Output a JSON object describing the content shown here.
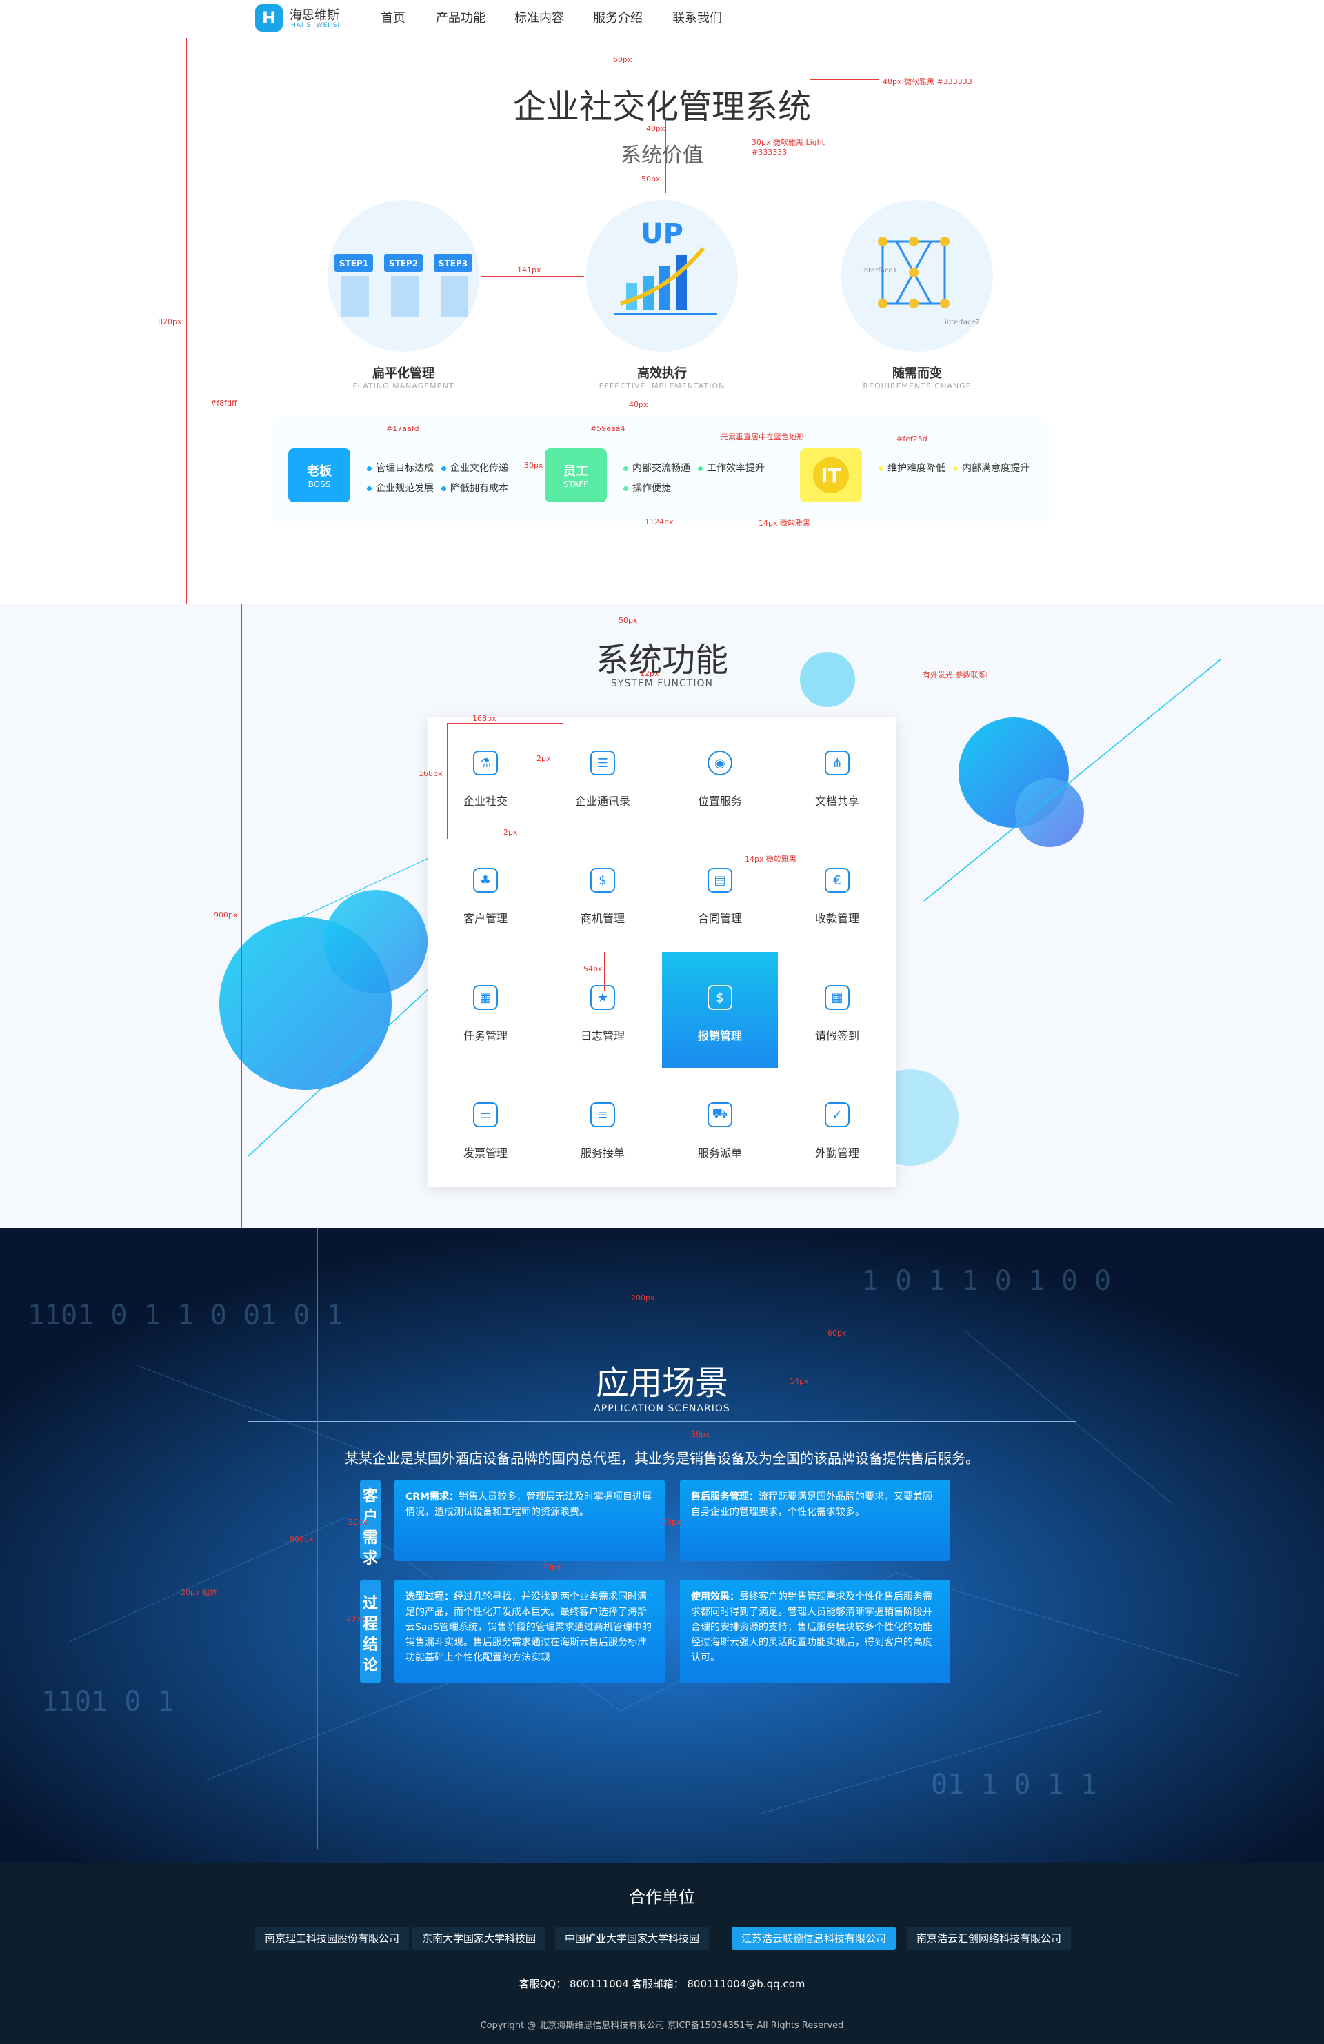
{
  "header": {
    "logo_text": "海思维斯",
    "logo_sub": "HAI SI WEI SI",
    "nav": [
      "首页",
      "产品功能",
      "标准内容",
      "服务介绍",
      "联系我们"
    ]
  },
  "section1": {
    "title": "企业社交化管理系统",
    "subtitle": "系统价值",
    "features": [
      {
        "title": "扁平化管理",
        "sub": "FLATING MANAGEMENT",
        "icon": "steps-icon",
        "steps": [
          "STEP1",
          "STEP2",
          "STEP3"
        ]
      },
      {
        "title": "高效执行",
        "sub": "EFFECTIVE IMPLEMENTATION",
        "icon": "up-chart-icon",
        "badge": "UP"
      },
      {
        "title": "随需而变",
        "sub": "REQUIREMENTS CHANGE",
        "icon": "interface-network-icon",
        "labels": [
          "interface1",
          "interface2"
        ]
      }
    ],
    "roles": [
      {
        "name": "老板",
        "en": "BOSS",
        "color": "#17aafd",
        "items": [
          "管理目标达成",
          "企业文化传递",
          "企业规范发展",
          "降低拥有成本"
        ]
      },
      {
        "name": "员工",
        "en": "STAFF",
        "color": "#59eaa4",
        "items": [
          "内部交流畅通",
          "工作效率提升",
          "操作便捷"
        ]
      },
      {
        "name": "IT",
        "en": "",
        "color": "#fef25d",
        "items": [
          "维护难度降低",
          "内部满意度提升"
        ]
      }
    ]
  },
  "annotations": {
    "a1": "60px",
    "a2": "48px 微软雅黑 #333333",
    "a3": "40px",
    "a4": "30px 微软雅黑 Light #333333",
    "a5": "50px",
    "a6": "141px",
    "a7": "820px",
    "a8": "#f8fdff",
    "a9": "#17aafd",
    "a10": "#59eaa4",
    "a11": "#fef25d",
    "a12": "元素垂直居中在蓝色地形",
    "a13": "40px",
    "a14": "30px",
    "a15": "1124px",
    "a16": "14px 微软雅黑",
    "a17": "50px",
    "a18": "12px",
    "a19": "有外发光 参数联系I",
    "a20": "168px",
    "a21": "168px",
    "a22": "2px",
    "a23": "2px",
    "a24": "14px 微软雅黑",
    "a25": "54px",
    "a26": "900px",
    "a27": "200px",
    "a28": "60px",
    "a29": "14px",
    "a30": "30px",
    "a31": "20px",
    "a32": "20px",
    "a33": "20px",
    "a34": "20px",
    "a35": "900px",
    "a36": "20px 粗体"
  },
  "section2": {
    "title": "系统功能",
    "subtitle": "SYSTEM FUNCTION",
    "cells": [
      {
        "label": "企业社交",
        "icon": "flask-icon",
        "glyph": "⚗"
      },
      {
        "label": "企业通讯录",
        "icon": "contacts-icon",
        "glyph": "☰"
      },
      {
        "label": "位置服务",
        "icon": "location-icon",
        "glyph": "◉"
      },
      {
        "label": "文档共享",
        "icon": "share-icon",
        "glyph": "⋔"
      },
      {
        "label": "客户管理",
        "icon": "customers-icon",
        "glyph": "♣"
      },
      {
        "label": "商机管理",
        "icon": "opportunity-icon",
        "glyph": "$"
      },
      {
        "label": "合同管理",
        "icon": "contract-icon",
        "glyph": "▤"
      },
      {
        "label": "收款管理",
        "icon": "payment-icon",
        "glyph": "€"
      },
      {
        "label": "任务管理",
        "icon": "task-icon",
        "glyph": "▦"
      },
      {
        "label": "日志管理",
        "icon": "log-icon",
        "glyph": "★"
      },
      {
        "label": "报销管理",
        "icon": "reimburse-icon",
        "glyph": "$"
      },
      {
        "label": "请假签到",
        "icon": "calendar-icon",
        "glyph": "▦"
      },
      {
        "label": "发票管理",
        "icon": "invoice-icon",
        "glyph": "▭"
      },
      {
        "label": "服务接单",
        "icon": "clipboard-icon",
        "glyph": "≡"
      },
      {
        "label": "服务派单",
        "icon": "truck-icon",
        "glyph": "⛟"
      },
      {
        "label": "外勤管理",
        "icon": "fieldwork-icon",
        "glyph": "✓"
      }
    ],
    "active_index": 10
  },
  "section3": {
    "title": "应用场景",
    "subtitle": "APPLICATION SCENARIOS",
    "desc": "某某企业是某国外酒店设备品牌的国内总代理，其业务是销售设备及为全国的该品牌设备提供售后服务。",
    "tabs": [
      "客户需求",
      "过程结论"
    ],
    "cards": [
      {
        "head": "CRM需求：",
        "text": "销售人员较多，管理层无法及时掌握项目进展情况，造成测试设备和工程师的资源浪费。"
      },
      {
        "head": "售后服务管理：",
        "text": "流程既要满足国外品牌的要求，又要兼顾自身企业的管理要求，个性化需求较多。"
      },
      {
        "head": "选型过程：",
        "text": "经过几轮寻找，并没找到两个业务需求同时满足的产品，而个性化开发成本巨大。最终客户选择了海斯云SaaS管理系统，销售阶段的管理需求通过商机管理中的销售漏斗实现。售后服务需求通过在海斯云售后服务标准功能基础上个性化配置的方法实现"
      },
      {
        "head": "使用效果：",
        "text": "最终客户的销售管理需求及个性化售后服务需求都同时得到了满足。管理人员能够清晰掌握销售阶段并合理的安排资源的支持；售后服务模块较多个性化的功能经过海斯云强大的灵活配置功能实现后，得到客户的高度认可。"
      }
    ]
  },
  "footer": {
    "title": "合作单位",
    "partners": [
      "南京理工科技园股份有限公司",
      "东南大学国家大学科技园",
      "中国矿业大学国家大学科技园",
      "江苏浩云联德信息科技有限公司",
      "南京浩云汇创网络科技有限公司"
    ],
    "active_partner": 3,
    "contact": "客服QQ： 800111004    客服邮箱： 800111004@b.qq.com",
    "copyright": "Copyright @ 北京海斯维思信息科技有限公司      京ICP备15034351号      All Rights Reserved"
  }
}
